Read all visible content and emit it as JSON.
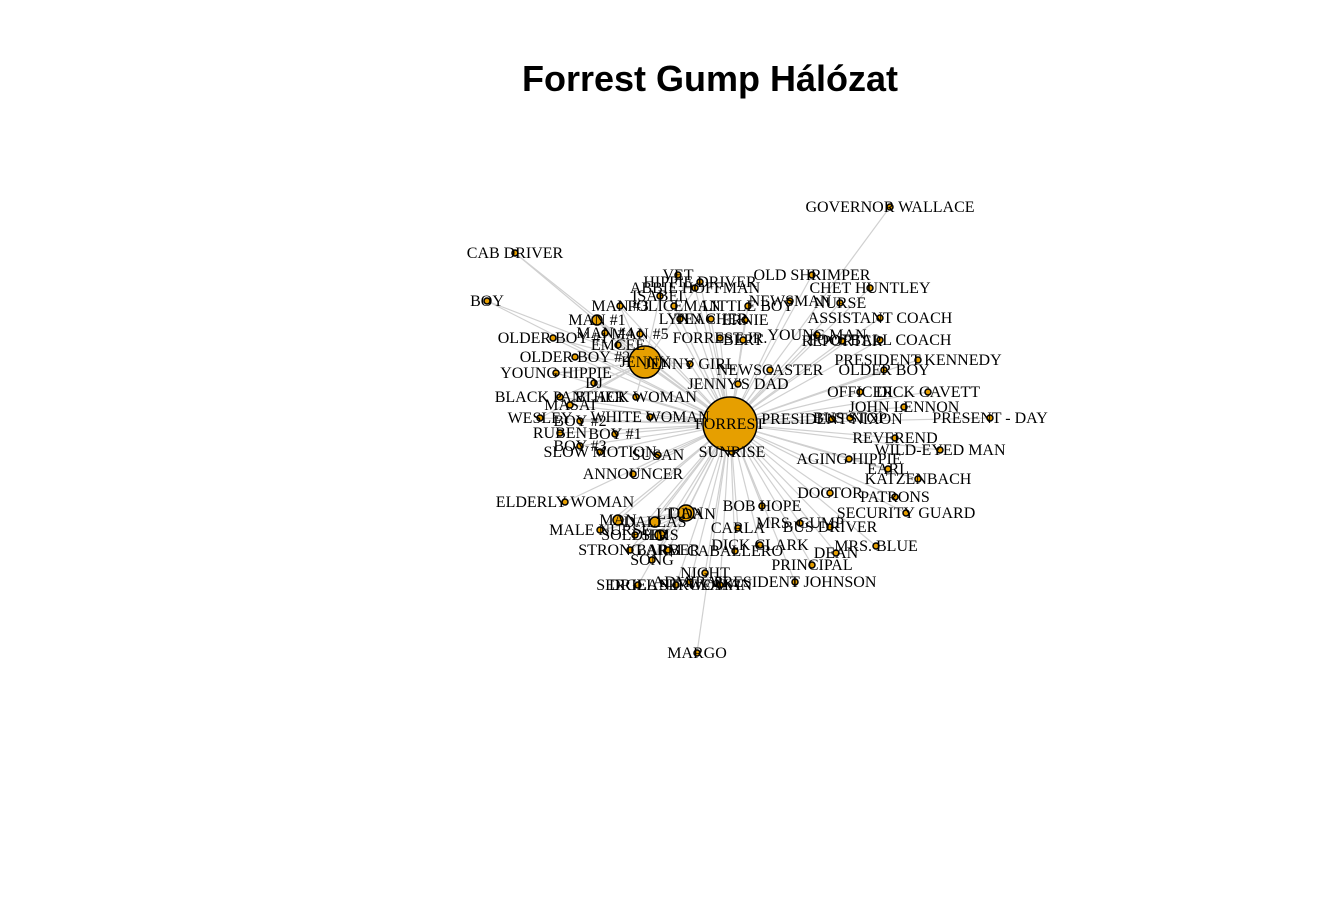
{
  "title": "Forrest Gump Hálózat",
  "colors": {
    "node_fill": "#e69f00",
    "node_stroke": "#000000",
    "edge": "#d0d0d0"
  },
  "hubs": {
    "primary": "FORREST",
    "secondary": [
      "JENNY",
      "DAN"
    ]
  },
  "nodes": [
    {
      "label": "FORREST",
      "degree": 60
    },
    {
      "label": "JENNY",
      "degree": 18
    },
    {
      "label": "DAN",
      "degree": 8
    },
    {
      "label": "GOVERNOR WALLACE",
      "degree": 1
    },
    {
      "label": "CAB DRIVER",
      "degree": 1
    },
    {
      "label": "BOY",
      "degree": 1
    },
    {
      "label": "OLD SHRIMPER",
      "degree": 1
    },
    {
      "label": "CHET HUNTLEY",
      "degree": 1
    },
    {
      "label": "HIPPIE DRIVER",
      "degree": 1
    },
    {
      "label": "VET",
      "degree": 1
    },
    {
      "label": "ABBIE HOFFMAN",
      "degree": 1
    },
    {
      "label": "ISABEL",
      "degree": 1
    },
    {
      "label": "POLICEMAN",
      "degree": 1
    },
    {
      "label": "LITTLE BOY",
      "degree": 1
    },
    {
      "label": "NEWSMAN",
      "degree": 1
    },
    {
      "label": "NURSE",
      "degree": 1
    },
    {
      "label": "MARGO",
      "degree": 1
    },
    {
      "label": "MAN #1",
      "degree": 2
    },
    {
      "label": "MAN #3",
      "degree": 1
    },
    {
      "label": "LYNN",
      "degree": 1
    },
    {
      "label": "TEACHER",
      "degree": 1
    },
    {
      "label": "ERNIE",
      "degree": 1
    },
    {
      "label": "ASSISTANT COACH",
      "degree": 1
    },
    {
      "label": "MAN #4",
      "degree": 1
    },
    {
      "label": "MAN #5",
      "degree": 1
    },
    {
      "label": "FORREST JR.",
      "degree": 1
    },
    {
      "label": "YOUNG MAN",
      "degree": 1
    },
    {
      "label": "FOOTBALL COACH",
      "degree": 1
    },
    {
      "label": "REPORTER",
      "degree": 1
    },
    {
      "label": "BERT",
      "degree": 1
    },
    {
      "label": "EMCEE",
      "degree": 1
    },
    {
      "label": "OLDER BOY #1",
      "degree": 1
    },
    {
      "label": "OLDER BOY #2",
      "degree": 1
    },
    {
      "label": "JENNY GIRL",
      "degree": 1
    },
    {
      "label": "PRESIDENT KENNEDY",
      "degree": 1
    },
    {
      "label": "YOUNG HIPPIE",
      "degree": 1
    },
    {
      "label": "NEWSCASTER",
      "degree": 1
    },
    {
      "label": "OLDER BOY",
      "degree": 1
    },
    {
      "label": "JENNY'S DAD",
      "degree": 1
    },
    {
      "label": "DJ",
      "degree": 1
    },
    {
      "label": "OFFICER",
      "degree": 1
    },
    {
      "label": "DICK CAVETT",
      "degree": 1
    },
    {
      "label": "BLACK PANTHER",
      "degree": 1
    },
    {
      "label": "BLACK WOMAN",
      "degree": 1
    },
    {
      "label": "MASAI",
      "degree": 1
    },
    {
      "label": "JOHN LENNON",
      "degree": 1
    },
    {
      "label": "WESLEY",
      "degree": 1
    },
    {
      "label": "WHITE WOMAN",
      "degree": 1
    },
    {
      "label": "PRESIDENT NIXON",
      "degree": 1
    },
    {
      "label": "BUS STOP",
      "degree": 1
    },
    {
      "label": "PRESENT - DAY",
      "degree": 1
    },
    {
      "label": "BOY #2",
      "degree": 1
    },
    {
      "label": "RUBEN",
      "degree": 1
    },
    {
      "label": "BOY #1",
      "degree": 1
    },
    {
      "label": "REVEREND",
      "degree": 1
    },
    {
      "label": "BOY #3",
      "degree": 1
    },
    {
      "label": "WILD-EYED MAN",
      "degree": 1
    },
    {
      "label": "SLOW MOTION",
      "degree": 1
    },
    {
      "label": "SUSAN",
      "degree": 1
    },
    {
      "label": "SUNRISE",
      "degree": 1
    },
    {
      "label": "AGING HIPPIE",
      "degree": 1
    },
    {
      "label": "EARL",
      "degree": 1
    },
    {
      "label": "ANNOUNCER",
      "degree": 1
    },
    {
      "label": "KATZENBACH",
      "degree": 1
    },
    {
      "label": "DOCTOR",
      "degree": 1
    },
    {
      "label": "PATRONS",
      "degree": 1
    },
    {
      "label": "ELDERLY WOMAN",
      "degree": 1
    },
    {
      "label": "LT. DAN",
      "degree": 1
    },
    {
      "label": "BOB HOPE",
      "degree": 1
    },
    {
      "label": "SECURITY GUARD",
      "degree": 1
    },
    {
      "label": "MAN",
      "degree": 2
    },
    {
      "label": "DALLAS",
      "degree": 2
    },
    {
      "label": "CARLA",
      "degree": 1
    },
    {
      "label": "MRS. GUMP",
      "degree": 1
    },
    {
      "label": "BUS DRIVER",
      "degree": 1
    },
    {
      "label": "MALE NURSE",
      "degree": 1
    },
    {
      "label": "SOLDIER",
      "degree": 1
    },
    {
      "label": "SIMS",
      "degree": 2
    },
    {
      "label": "DICK CLARK",
      "degree": 1
    },
    {
      "label": "DEAN",
      "degree": 1
    },
    {
      "label": "MRS. BLUE",
      "degree": 1
    },
    {
      "label": "STRONG ARM",
      "degree": 1
    },
    {
      "label": "BARBER",
      "degree": 1
    },
    {
      "label": "CABALLERO",
      "degree": 1
    },
    {
      "label": "SONG",
      "degree": 1
    },
    {
      "label": "PRINCIPAL",
      "degree": 1
    },
    {
      "label": "NIGHT",
      "degree": 1
    },
    {
      "label": "PRESIDENT JOHNSON",
      "degree": 1
    },
    {
      "label": "ADMIRAL",
      "degree": 1
    },
    {
      "label": "DRILL SERGEANT",
      "degree": 1
    },
    {
      "label": "WOMAN",
      "degree": 1
    },
    {
      "label": "SERGEANT",
      "degree": 1
    }
  ]
}
